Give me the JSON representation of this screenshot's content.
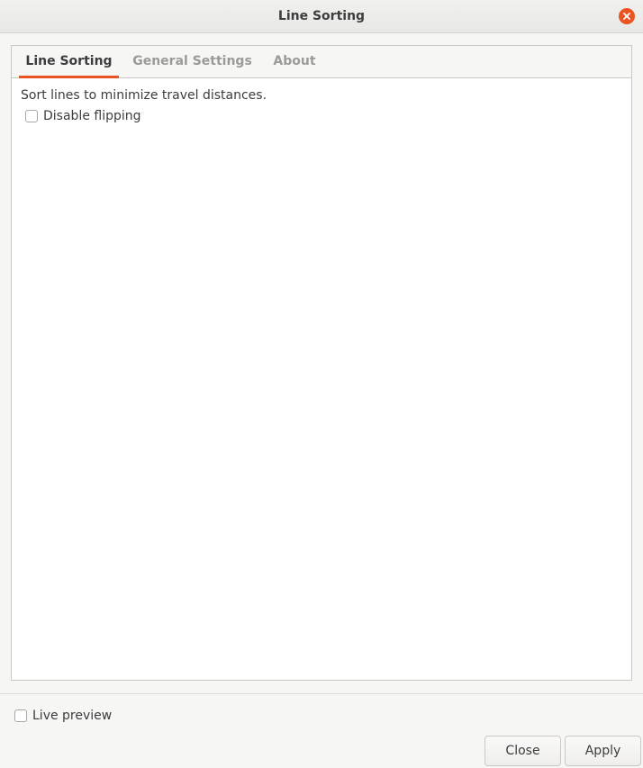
{
  "window": {
    "title": "Line Sorting",
    "close_icon": "close-icon",
    "accent_color": "#e95420"
  },
  "tabs": [
    {
      "label": "Line Sorting",
      "active": true
    },
    {
      "label": "General Settings",
      "active": false
    },
    {
      "label": "About",
      "active": false
    }
  ],
  "line_sorting": {
    "description": "Sort lines to minimize travel distances.",
    "disable_flipping": {
      "label": "Disable flipping",
      "checked": false
    }
  },
  "footer": {
    "live_preview": {
      "label": "Live preview",
      "checked": false
    },
    "close_label": "Close",
    "apply_label": "Apply"
  }
}
